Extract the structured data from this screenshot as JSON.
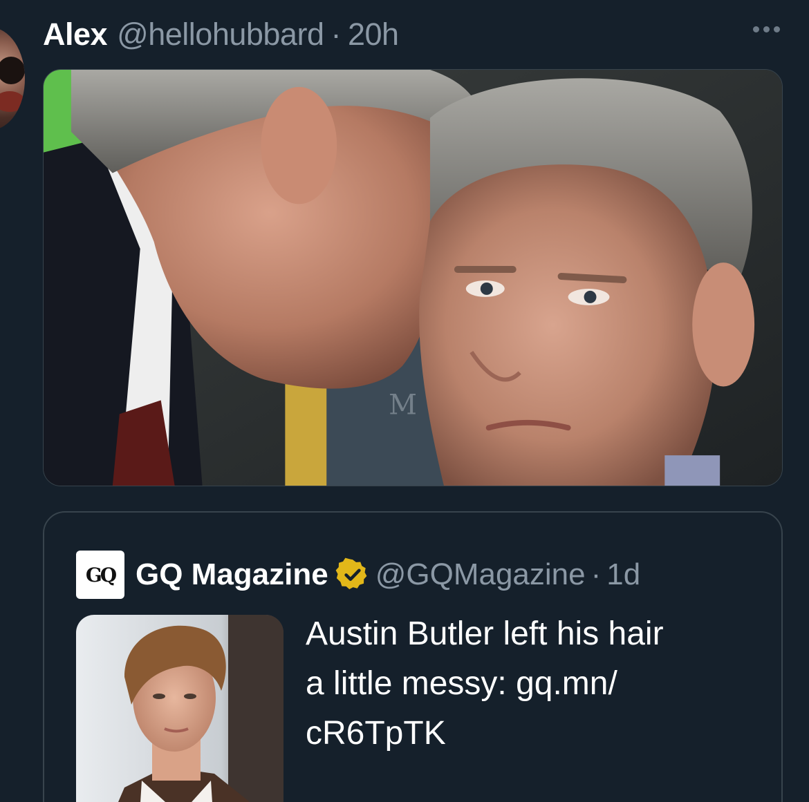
{
  "tweet": {
    "author_name": "Alex",
    "author_handle": "@hellohubbard",
    "separator": "·",
    "time": "20h",
    "more_icon": "more-horizontal-icon"
  },
  "quoted_tweet": {
    "author_name": "GQ Magazine",
    "logo_text": "GQ",
    "verified_icon": "verified-badge-icon",
    "verified_color": "#e2b719",
    "author_handle": "@GQMagazine",
    "separator": "·",
    "time": "1d",
    "text_lines": [
      "Austin Butler left his hair",
      "a little messy: gq.mn/",
      "cR6TpTK"
    ]
  },
  "colors": {
    "background": "#15202b",
    "secondary_text": "#8b98a5",
    "border": "#38444d"
  }
}
